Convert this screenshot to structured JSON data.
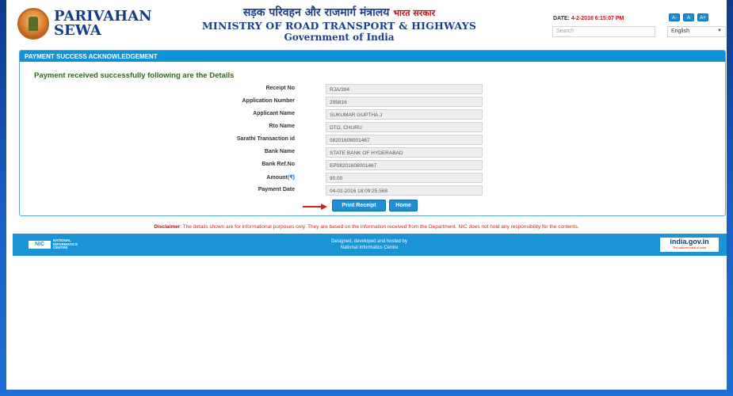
{
  "header": {
    "brand_line1": "PARIVAHAN",
    "brand_line2": "SEWA",
    "title_hindi": "सड़क परिवहन और राजमार्ग मंत्रालय",
    "title_hindi_suffix": "भारत सरकार",
    "title_english": "MINISTRY OF ROAD TRANSPORT & HIGHWAYS",
    "title_government": "Government of India",
    "date_label": "DATE:",
    "date_value": "4-2-2016 6:15:07 PM",
    "font_buttons": [
      "A-",
      "A",
      "A+"
    ],
    "search_placeholder": "Search",
    "language_selected": "English"
  },
  "panel": {
    "title": "PAYMENT SUCCESS ACKNOWLEDGEMENT",
    "success_message": "Payment received successfully following are the Details",
    "fields": [
      {
        "label": "Receipt No",
        "value": "RJA/394"
      },
      {
        "label": "Application Number",
        "value": "295816"
      },
      {
        "label": "Applicant Name",
        "value": "SUKUMAR GUPTHA J"
      },
      {
        "label": "Rto Name",
        "value": "DTO, CHURU"
      },
      {
        "label": "Sarathi Transaction id",
        "value": "08201608001467"
      },
      {
        "label": "Bank Name",
        "value": "STATE BANK OF HYDERABAD"
      },
      {
        "label": "Bank Ref.No",
        "value": "EP08201608001467"
      },
      {
        "label": "Amount",
        "label_suffix": "(₹)",
        "value": "90.00"
      },
      {
        "label": "Payment Date",
        "value": "04-02-2016 18:09:25.568"
      }
    ],
    "print_button": "Print Receipt",
    "home_button": "Home"
  },
  "disclaimer": {
    "label": "Disclaimer",
    "text": ": The details shown are for informational purposes only. They are based on the information received from the Department. NIC does not hold any responsibility for the contents."
  },
  "footer": {
    "nic_mark": "NIC",
    "nic_text_1": "NATIONAL",
    "nic_text_2": "INFORMATICS",
    "nic_text_3": "CENTRE",
    "center_line1": "Designed, developed and hosted by",
    "center_line2": "National Informatics Centre",
    "india_portal": "india.gov.in",
    "india_tagline": "The national portal of India"
  },
  "colors": {
    "panel_header": "#1192d6",
    "success_text": "#2e6b12",
    "disclaimer": "#d12a1f",
    "footer": "#1b94d6",
    "background_blue": "#1a5fc8"
  }
}
